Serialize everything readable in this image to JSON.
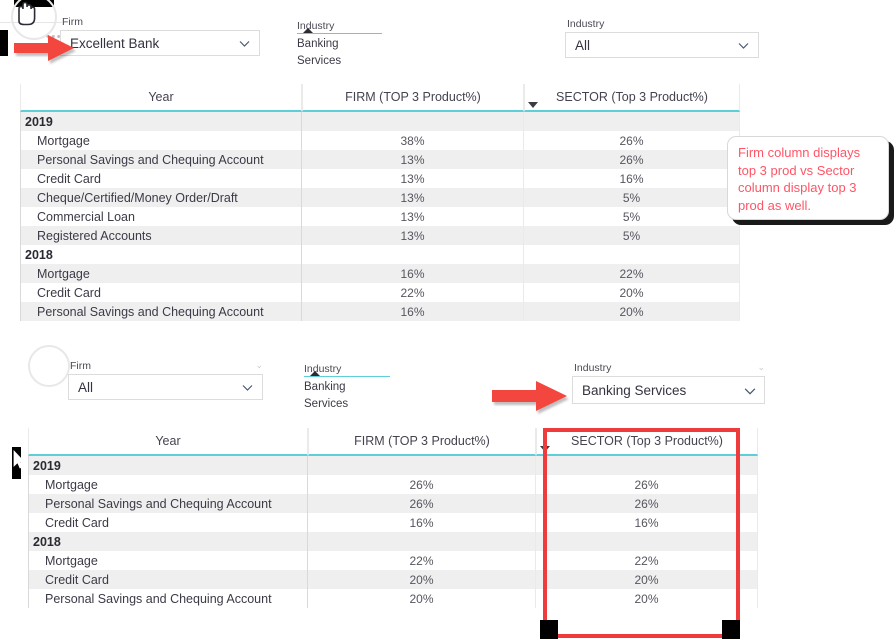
{
  "section_top": {
    "firm_slicer": {
      "label": "Firm",
      "value": "Excellent Bank",
      "chevron_icon": "chevron-down-icon"
    },
    "industry_slicer": {
      "label": "Industry",
      "value": "Banking Services",
      "caret_icon": "caret-up-icon"
    },
    "industry_dropdown": {
      "label": "Industry",
      "value": "All",
      "chevron_icon": "chevron-down-icon"
    },
    "table": {
      "columns": [
        "Year",
        "FIRM (TOP 3 Product%)",
        "SECTOR (Top 3 Product%)"
      ],
      "sort_indicator_icon": "sort-descending-icon",
      "rows": [
        {
          "type": "group",
          "label": "2019",
          "firm": "",
          "sector": ""
        },
        {
          "type": "item",
          "label": "Mortgage",
          "firm": "38%",
          "sector": "26%"
        },
        {
          "type": "item",
          "label": "Personal Savings and Chequing Account",
          "firm": "13%",
          "sector": "26%"
        },
        {
          "type": "item",
          "label": "Credit Card",
          "firm": "13%",
          "sector": "16%"
        },
        {
          "type": "item",
          "label": "Cheque/Certified/Money Order/Draft",
          "firm": "13%",
          "sector": "5%"
        },
        {
          "type": "item",
          "label": "Commercial Loan",
          "firm": "13%",
          "sector": "5%"
        },
        {
          "type": "item",
          "label": "Registered Accounts",
          "firm": "13%",
          "sector": "5%"
        },
        {
          "type": "group",
          "label": "2018",
          "firm": "",
          "sector": ""
        },
        {
          "type": "item",
          "label": "Mortgage",
          "firm": "16%",
          "sector": "22%"
        },
        {
          "type": "item",
          "label": "Credit Card",
          "firm": "22%",
          "sector": "20%"
        },
        {
          "type": "item",
          "label": "Personal Savings and Chequing Account",
          "firm": "16%",
          "sector": "20%"
        }
      ]
    }
  },
  "section_bottom": {
    "firm_dropdown": {
      "label": "Firm",
      "value": "All",
      "chevron_icon": "chevron-down-icon",
      "small_chevron_icon": "chevron-down-small-icon"
    },
    "industry_slicer": {
      "label": "Industry",
      "value": "Banking Services",
      "caret_icon": "caret-up-icon"
    },
    "industry_dropdown": {
      "label": "Industry",
      "value": "Banking Services",
      "chevron_icon": "chevron-down-icon",
      "small_chevron_icon": "chevron-down-small-icon"
    },
    "table": {
      "columns": [
        "Year",
        "FIRM (TOP 3 Product%)",
        "SECTOR (Top 3 Product%)"
      ],
      "sort_indicator_icon": "sort-descending-icon",
      "rows": [
        {
          "type": "group",
          "label": "2019",
          "firm": "",
          "sector": ""
        },
        {
          "type": "item",
          "label": "Mortgage",
          "firm": "26%",
          "sector": "26%"
        },
        {
          "type": "item",
          "label": "Personal Savings and Chequing Account",
          "firm": "26%",
          "sector": "26%"
        },
        {
          "type": "item",
          "label": "Credit Card",
          "firm": "16%",
          "sector": "16%"
        },
        {
          "type": "group",
          "label": "2018",
          "firm": "",
          "sector": ""
        },
        {
          "type": "item",
          "label": "Mortgage",
          "firm": "22%",
          "sector": "22%"
        },
        {
          "type": "item",
          "label": "Credit Card",
          "firm": "20%",
          "sector": "20%"
        },
        {
          "type": "item",
          "label": "Personal Savings and Chequing Account",
          "firm": "20%",
          "sector": "20%"
        }
      ]
    }
  },
  "annotations": {
    "callout_text": "Firm column displays top 3 prod vs Sector column display top 3 prod as well.",
    "arrow_top_icon": "red-arrow-right-icon",
    "arrow_bottom_icon": "red-arrow-right-icon",
    "highlight_rect_name": "sector-column-highlight"
  },
  "colors": {
    "accent_teal": "#5ecfd8",
    "annotation_red": "#ff5566",
    "highlight_red": "#ef3b3b",
    "row_stripe": "#efefef"
  }
}
